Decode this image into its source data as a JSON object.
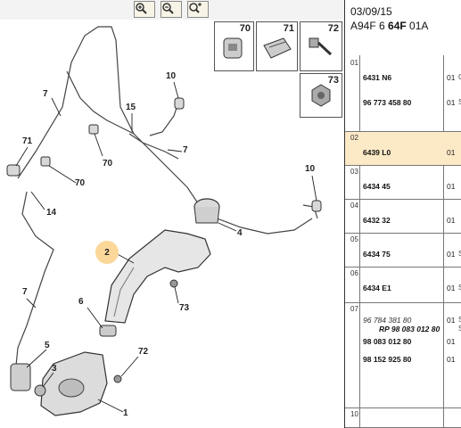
{
  "toolbar": {
    "buttons": [
      {
        "name": "zoom-in-button",
        "icon": "zoom-in-icon"
      },
      {
        "name": "zoom-out-button",
        "icon": "zoom-out-icon"
      },
      {
        "name": "zoom-fit-button",
        "icon": "zoom-fit-icon"
      }
    ]
  },
  "insets": {
    "n70": "70",
    "n71": "71",
    "n72": "72",
    "n73": "73"
  },
  "callouts": {
    "c7a": "7",
    "c10a": "10",
    "c15": "15",
    "c7b": "7",
    "c71": "71",
    "c70a": "70",
    "c70b": "70",
    "c10b": "10",
    "c14": "14",
    "c4": "4",
    "c2": "2",
    "c7c": "7",
    "c6": "6",
    "c73": "73",
    "c5": "5",
    "c72": "72",
    "c3": "3",
    "c1": "1"
  },
  "header": {
    "date": "03/09/15",
    "ref_prefix": "A94F 6 ",
    "ref_bold": "64F",
    "ref_suffix": " 01A"
  },
  "parts": [
    {
      "index": "01",
      "numbers": [
        {
          "text": "6431 N6",
          "style": "bold"
        },
        {
          "text": "96 773 458 80",
          "style": "bold"
        }
      ],
      "qty": [
        "01",
        "01"
      ],
      "edge": [
        "C",
        "S"
      ],
      "selected": false
    },
    {
      "index": "02",
      "numbers": [
        {
          "text": "6439 L0",
          "style": "bold"
        }
      ],
      "qty": [
        "01"
      ],
      "edge": [],
      "selected": true
    },
    {
      "index": "03",
      "numbers": [
        {
          "text": "6434 45",
          "style": "bold"
        }
      ],
      "qty": [
        "01"
      ],
      "edge": [],
      "selected": false
    },
    {
      "index": "04",
      "numbers": [
        {
          "text": "6432 32",
          "style": "bold"
        }
      ],
      "qty": [
        "01"
      ],
      "edge": [],
      "selected": false
    },
    {
      "index": "05",
      "numbers": [
        {
          "text": "6434 75",
          "style": "bold"
        }
      ],
      "qty": [
        "01"
      ],
      "edge": [
        "S"
      ],
      "selected": false
    },
    {
      "index": "06",
      "numbers": [
        {
          "text": "6434 E1",
          "style": "bold"
        }
      ],
      "qty": [
        "01"
      ],
      "edge": [
        "S"
      ],
      "selected": false
    },
    {
      "index": "07",
      "numbers": [
        {
          "text": "96 784 381 80",
          "style": "italic"
        },
        {
          "text": "RP 98 083 012 80",
          "style": "rp"
        },
        {
          "text": "98 083 012 80",
          "style": "bold"
        },
        {
          "text": "98 152 925 80",
          "style": "bold"
        }
      ],
      "qty": [
        "01",
        "",
        "01",
        "01"
      ],
      "edge": [
        "S",
        "S",
        "",
        ""
      ],
      "selected": false
    },
    {
      "index": "10",
      "numbers": [],
      "qty": [],
      "edge": [],
      "selected": false
    }
  ],
  "colors": {
    "selected_row": "#fce9c6",
    "callout_highlight": "#fbd89a",
    "toolbar_button": "#f7f3e6"
  }
}
